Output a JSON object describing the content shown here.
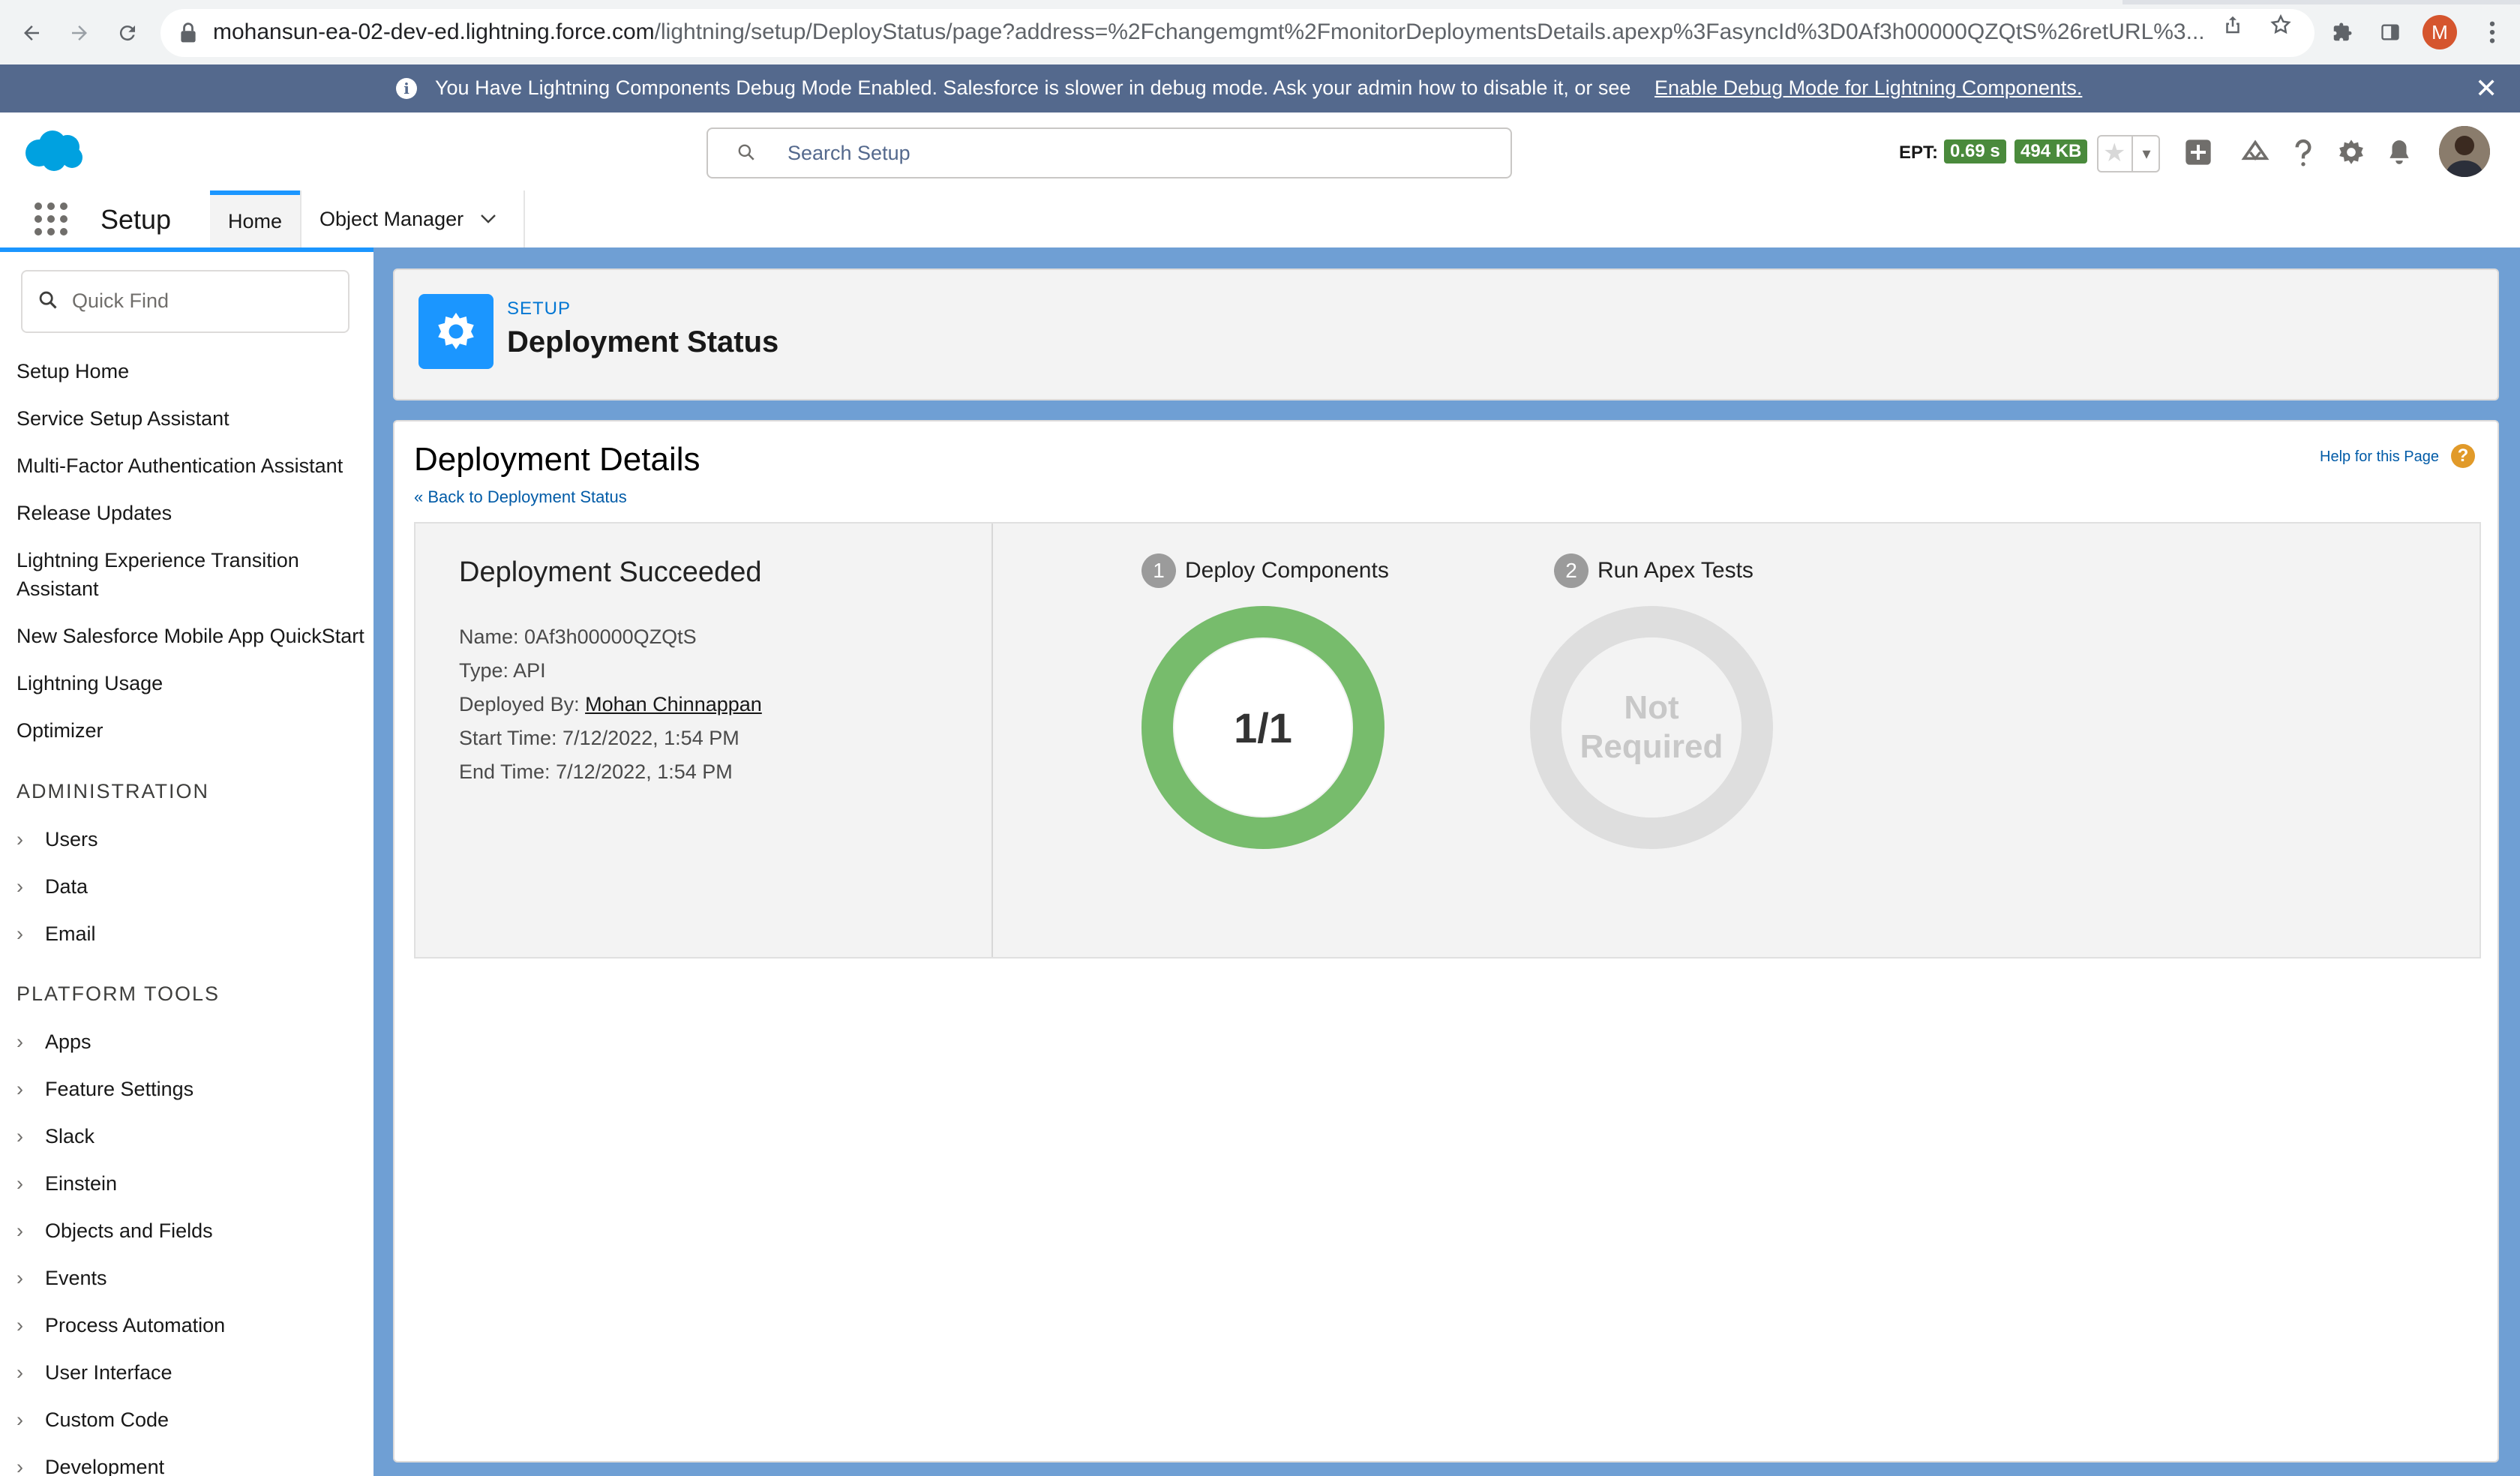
{
  "browser": {
    "url_host": "mohansun-ea-02-dev-ed.lightning.force.com",
    "url_path": "/lightning/setup/DeployStatus/page?address=%2Fchangemgmt%2FmonitorDeploymentsDetails.apexp%3FasyncId%3D0Af3h00000QZQtS%26retURL%3...",
    "profile_initial": "M"
  },
  "banner": {
    "message": "You Have Lightning Components Debug Mode Enabled. Salesforce is slower in debug mode. Ask your admin how to disable it, or see",
    "link": "Enable Debug Mode for Lightning Components."
  },
  "header": {
    "search_placeholder": "Search Setup",
    "ept_label": "EPT:",
    "ept_time": "0.69 s",
    "ept_size": "494 KB"
  },
  "appnav": {
    "app_name": "Setup",
    "tabs": [
      {
        "label": "Home"
      },
      {
        "label": "Object Manager"
      }
    ]
  },
  "sidebar": {
    "quick_find_placeholder": "Quick Find",
    "links": [
      "Setup Home",
      "Service Setup Assistant",
      "Multi-Factor Authentication Assistant",
      "Release Updates",
      "Lightning Experience Transition Assistant",
      "New Salesforce Mobile App QuickStart",
      "Lightning Usage",
      "Optimizer"
    ],
    "sections": [
      {
        "heading": "ADMINISTRATION",
        "items": [
          "Users",
          "Data",
          "Email"
        ]
      },
      {
        "heading": "PLATFORM TOOLS",
        "items": [
          "Apps",
          "Feature Settings",
          "Slack",
          "Einstein",
          "Objects and Fields",
          "Events",
          "Process Automation",
          "User Interface",
          "Custom Code",
          "Development"
        ]
      }
    ]
  },
  "page_header": {
    "eyebrow": "SETUP",
    "title": "Deployment Status"
  },
  "details": {
    "title": "Deployment Details",
    "back_link": "« Back to Deployment Status",
    "help_link": "Help for this Page",
    "help_icon": "?",
    "status": "Deployment Succeeded",
    "name_label": "Name:",
    "name_value": "0Af3h00000QZQtS",
    "type_label": "Type:",
    "type_value": "API",
    "deployed_by_label": "Deployed By:",
    "deployed_by_value": "Mohan Chinnappan",
    "start_label": "Start Time:",
    "start_value": "7/12/2022, 1:54 PM",
    "end_label": "End Time:",
    "end_value": "7/12/2022, 1:54 PM",
    "steps": [
      {
        "num": "1",
        "label": "Deploy Components",
        "ring_text": "1/1",
        "progress": 1.0,
        "color": "#77bc6c"
      },
      {
        "num": "2",
        "label": "Run Apex Tests",
        "ring_text_line1": "Not",
        "ring_text_line2": "Required",
        "progress": 0,
        "color": "#dedede"
      }
    ]
  },
  "colors": {
    "banner_bg": "#54698d",
    "brand_blue": "#1b96ff",
    "success_green": "#77bc6c",
    "band_blue": "#6f9fd4"
  }
}
